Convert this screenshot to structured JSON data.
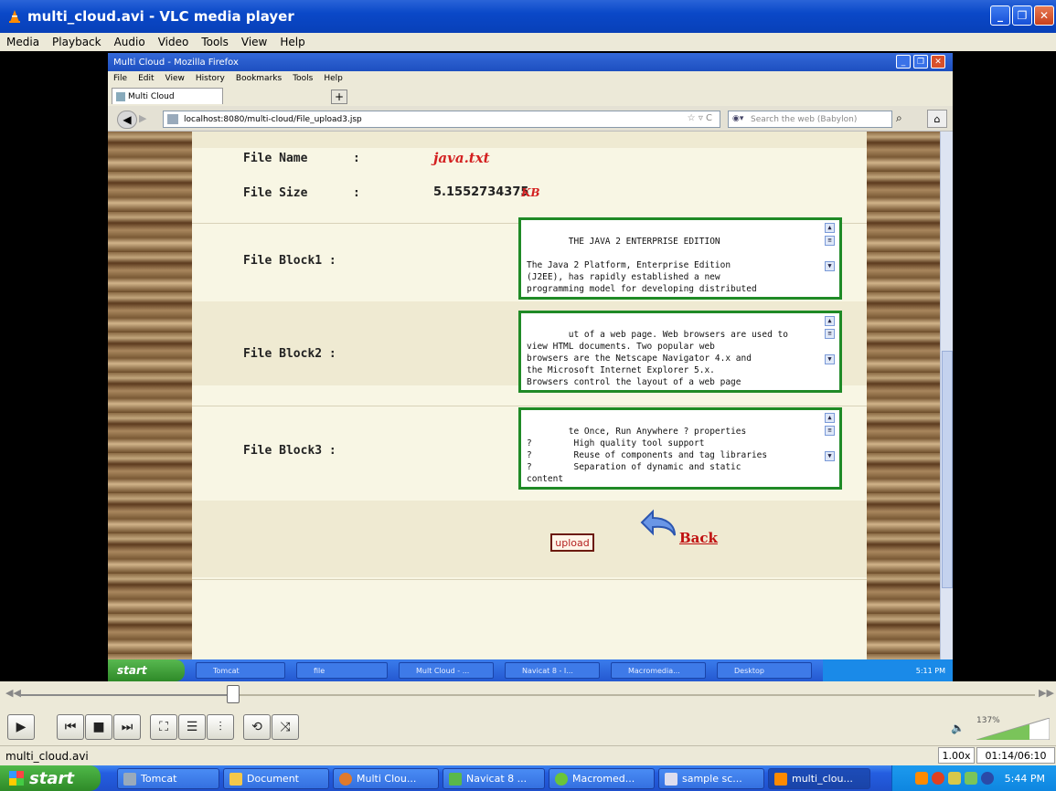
{
  "vlc": {
    "title": "multi_cloud.avi - VLC media player",
    "menu": [
      "Media",
      "Playback",
      "Audio",
      "Video",
      "Tools",
      "View",
      "Help"
    ],
    "seek_fraction": 0.21,
    "status_file": "multi_cloud.avi",
    "speed": "1.00x",
    "time": "01:14/06:10",
    "volume": "137%"
  },
  "firefox": {
    "title": "Multi Cloud - Mozilla Firefox",
    "menu": [
      "File",
      "Edit",
      "View",
      "History",
      "Bookmarks",
      "Tools",
      "Help"
    ],
    "tab_label": "Multi Cloud",
    "new_tab": "+",
    "url": "localhost:8080/multi-cloud/File_upload3.jsp",
    "search_placeholder": "Search the web (Babylon)"
  },
  "page": {
    "file_name_label": "File Name",
    "file_name_value": "java.txt",
    "file_size_label": "File Size",
    "file_size_value": "5.1552734375",
    "file_size_unit": "KB",
    "colon": ":",
    "blocks": [
      {
        "label": "File Block1 :",
        "text": "THE JAVA 2 ENTERPRISE EDITION\n\nThe Java 2 Platform, Enterprise Edition\n(J2EE), has rapidly established a new\nprogramming model for developing distributed"
      },
      {
        "label": "File Block2 :",
        "text": "ut of a web page. Web browsers are used to\nview HTML documents. Two popular web\nbrowsers are the Netscape Navigator 4.x and\nthe Microsoft Internet Explorer 5.x.\nBrowsers control the layout of a web page"
      },
      {
        "label": "File Block3 :",
        "text": "te Once, Run Anywhere ? properties\n?        High quality tool support\n?        Reuse of components and tag libraries\n?        Separation of dynamic and static\ncontent"
      }
    ],
    "upload_label": "upload",
    "back_label": "Back"
  },
  "inner_taskbar": {
    "start": "start",
    "items": [
      "Tomcat",
      "file",
      "Mult Cloud - ...",
      "Navicat 8 - I...",
      "Macromedia...",
      "Desktop"
    ],
    "clock": "5:11 PM"
  },
  "taskbar": {
    "start": "start",
    "items": [
      "Tomcat",
      "Document",
      "Multi Clou...",
      "Navicat 8 ...",
      "Macromed...",
      "sample sc...",
      "multi_clou..."
    ],
    "clock": "5:44 PM"
  }
}
